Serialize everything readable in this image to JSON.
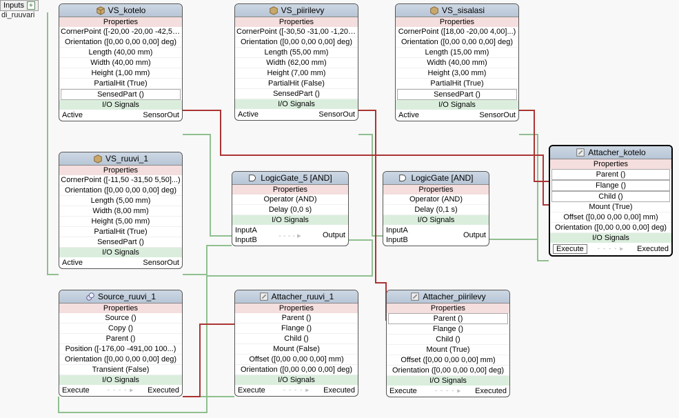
{
  "inputs": {
    "label": "Inputs",
    "items": [
      "di_ruuvari"
    ]
  },
  "labels": {
    "properties": "Properties",
    "io_signals": "I/O Signals",
    "active": "Active",
    "sensor_out": "SensorOut",
    "inputA": "InputA",
    "inputB": "InputB",
    "output": "Output",
    "execute": "Execute",
    "executed": "Executed"
  },
  "nodes": {
    "vs_kotelo": {
      "title": "VS_kotelo",
      "rows": [
        "CornerPoint ([-20,00 -20,00 -42,5...)",
        "Orientation ([0,00 0,00 0,00] deg)",
        "Length (40,00 mm)",
        "Width (40,00 mm)",
        "Height (1,00 mm)",
        "PartialHit (True)"
      ],
      "sensed": "SensedPart ()"
    },
    "vs_piirilevy": {
      "title": "VS_piirilevy",
      "rows": [
        "CornerPoint ([-30,50 -31,00 -1,20...)",
        "Orientation ([0,00 0,00 0,00] deg)",
        "Length (55,00 mm)",
        "Width (62,00 mm)",
        "Height (7,00 mm)",
        "PartialHit (False)"
      ],
      "sensed": "SensedPart ()"
    },
    "vs_sisalasi": {
      "title": "VS_sisalasi",
      "rows": [
        "CornerPoint ([18,00 -20,00 4,00]...)",
        "Orientation ([0,00 0,00 0,00] deg)",
        "Length (15,00 mm)",
        "Width (40,00 mm)",
        "Height (3,00 mm)",
        "PartialHit (True)"
      ],
      "sensed": "SensedPart ()"
    },
    "vs_ruuvi_1": {
      "title": "VS_ruuvi_1",
      "rows": [
        "CornerPoint ([-11,50 -31,50 5,50]...)",
        "Orientation ([0,00 0,00 0,00] deg)",
        "Length (5,00 mm)",
        "Width (8,00 mm)",
        "Height (5,00 mm)",
        "PartialHit (True)",
        "SensedPart ()"
      ]
    },
    "logicgate5": {
      "title": "LogicGate_5 [AND]",
      "rows": [
        "Operator (AND)",
        "Delay (0,0 s)"
      ]
    },
    "logicgate": {
      "title": "LogicGate [AND]",
      "rows": [
        "Operator (AND)",
        "Delay (0,1 s)"
      ]
    },
    "attacher_kotelo": {
      "title": "Attacher_kotelo",
      "slots": [
        "Parent ()",
        "Flange ()",
        "Child ()"
      ],
      "rows": [
        "Mount (True)",
        "Offset ([0,00 0,00 0,00] mm)",
        "Orientation ([0,00 0,00 0,00] deg)"
      ]
    },
    "source_ruuvi_1": {
      "title": "Source_ruuvi_1",
      "rows": [
        "Source ()",
        "Copy ()",
        "Parent ()",
        "Position ([-176,00 -491,00 100...)",
        "Orientation ([0,00 0,00 0,00] deg)",
        "Transient (False)"
      ]
    },
    "attacher_ruuvi_1": {
      "title": "Attacher_ruuvi_1",
      "rows": [
        "Parent ()",
        "Flange ()",
        "Child ()",
        "Mount (False)",
        "Offset ([0,00 0,00 0,00] mm)",
        "Orientation ([0,00 0,00 0,00] deg)"
      ]
    },
    "attacher_piirilevy": {
      "title": "Attacher_piirilevy",
      "slots_parent": "Parent ()",
      "rows": [
        "Flange ()",
        "Child ()",
        "Mount (True)",
        "Offset ([0,00 0,00 0,00] mm)",
        "Orientation ([0,00 0,00 0,00] deg)"
      ]
    }
  }
}
